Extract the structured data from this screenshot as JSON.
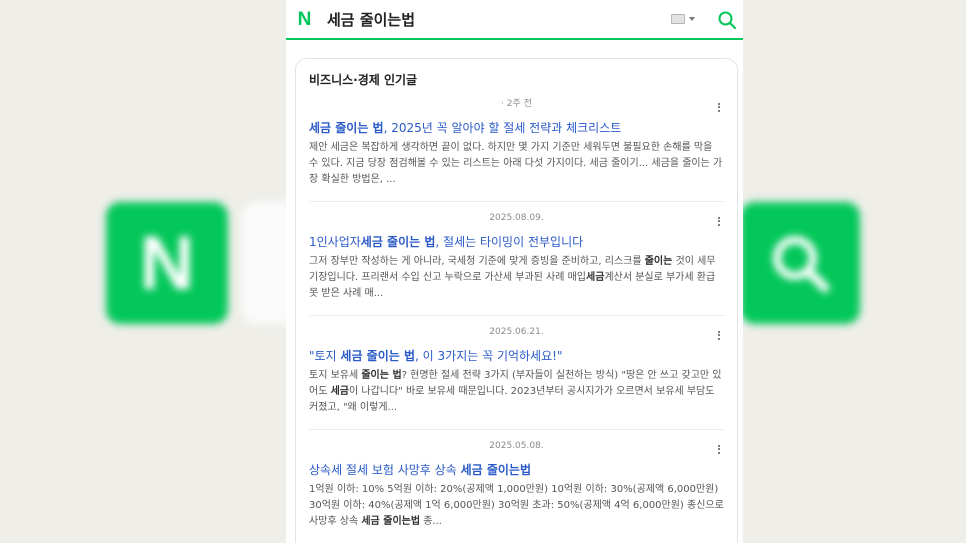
{
  "header": {
    "logo_letter": "N",
    "query": "세금 줄이는법"
  },
  "background": {
    "logo_letter": "N"
  },
  "section": {
    "title": "비즈니스·경제 인기글"
  },
  "results": [
    {
      "date": "· 2주 전",
      "title_bold": "세금 줄이는 법",
      "title_rest": ", 2025년 꼭 알아야 할 절세 전략과 체크리스트",
      "desc": "제안 세금은 복잡하게 생각하면 끝이 없다. 하지만 몇 가지 기준만 세워두면 불필요한 손해를 막을 수 있다. 지금 당장 점검해볼 수 있는 리스트는 아래 다섯 가지이다. 세금 줄이기... 세금을 줄이는 가장 확실한 방법은, ..."
    },
    {
      "date": "2025.08.09.",
      "title_pre": "1인사업자",
      "title_bold": "세금 줄이는 법",
      "title_rest": ", 절세는 타이밍이 전부입니다",
      "desc_parts": [
        "그저 장부만 작성하는 게 아니라, 국세청 기준에 맞게 증빙을 준비하고, 리스크를 ",
        "줄이는",
        " 것이 세무기장입니다. 프리랜서 수입 신고 누락으로 가산세 부과된 사례 매입",
        "세금",
        "계산서 분실로 부가세 환급 못 받은 사례 매..."
      ]
    },
    {
      "date": "2025.06.21.",
      "title_pre": "\"토지 ",
      "title_bold": "세금 줄이는 법",
      "title_rest": ", 이 3가지는 꼭 기억하세요!\"",
      "desc_parts": [
        "토지 보유세 ",
        "줄이는 법",
        "? 현명한 절세 전략 3가지 (부자들이 실천하는 방식) \"땅은 안 쓰고 갖고만 있어도 ",
        "세금",
        "이 나갑니다\" 바로 보유세 때문입니다. 2023년부터 공시지가가 오르면서 보유세 부담도 커졌고, \"왜 이렇게..."
      ]
    },
    {
      "date": "2025.05.08.",
      "title_pre": "상속세 절세 보험 사망후 상속 ",
      "title_bold": "세금 줄이는법",
      "title_rest": "",
      "desc_parts": [
        "1억원 이하: 10% 5억원 이하: 20%(공제액 1,000만원) 10억원 이하: 30%(공제액 6,000만원) 30억원 이하: 40%(공제액 1억 6,000만원) 30억원 초과: 50%(공제액 4억 6,000만원) 종신으로 사망후 상속 ",
        "세금 줄이는법",
        " 종..."
      ]
    }
  ],
  "colors": {
    "brand": "#03c75a",
    "link": "#2a5ac7"
  }
}
